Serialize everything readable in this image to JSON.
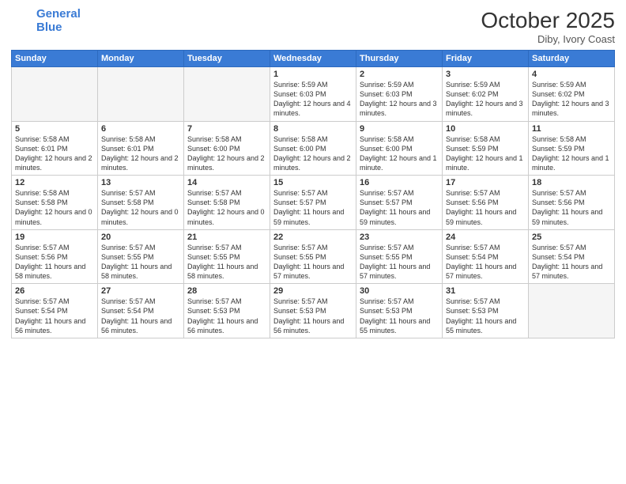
{
  "header": {
    "logo_line1": "General",
    "logo_line2": "Blue",
    "month": "October 2025",
    "location": "Diby, Ivory Coast"
  },
  "days_of_week": [
    "Sunday",
    "Monday",
    "Tuesday",
    "Wednesday",
    "Thursday",
    "Friday",
    "Saturday"
  ],
  "weeks": [
    [
      {
        "day": "",
        "data": ""
      },
      {
        "day": "",
        "data": ""
      },
      {
        "day": "",
        "data": ""
      },
      {
        "day": "1",
        "data": "Sunrise: 5:59 AM\nSunset: 6:03 PM\nDaylight: 12 hours and 4 minutes."
      },
      {
        "day": "2",
        "data": "Sunrise: 5:59 AM\nSunset: 6:03 PM\nDaylight: 12 hours and 3 minutes."
      },
      {
        "day": "3",
        "data": "Sunrise: 5:59 AM\nSunset: 6:02 PM\nDaylight: 12 hours and 3 minutes."
      },
      {
        "day": "4",
        "data": "Sunrise: 5:59 AM\nSunset: 6:02 PM\nDaylight: 12 hours and 3 minutes."
      }
    ],
    [
      {
        "day": "5",
        "data": "Sunrise: 5:58 AM\nSunset: 6:01 PM\nDaylight: 12 hours and 2 minutes."
      },
      {
        "day": "6",
        "data": "Sunrise: 5:58 AM\nSunset: 6:01 PM\nDaylight: 12 hours and 2 minutes."
      },
      {
        "day": "7",
        "data": "Sunrise: 5:58 AM\nSunset: 6:00 PM\nDaylight: 12 hours and 2 minutes."
      },
      {
        "day": "8",
        "data": "Sunrise: 5:58 AM\nSunset: 6:00 PM\nDaylight: 12 hours and 2 minutes."
      },
      {
        "day": "9",
        "data": "Sunrise: 5:58 AM\nSunset: 6:00 PM\nDaylight: 12 hours and 1 minute."
      },
      {
        "day": "10",
        "data": "Sunrise: 5:58 AM\nSunset: 5:59 PM\nDaylight: 12 hours and 1 minute."
      },
      {
        "day": "11",
        "data": "Sunrise: 5:58 AM\nSunset: 5:59 PM\nDaylight: 12 hours and 1 minute."
      }
    ],
    [
      {
        "day": "12",
        "data": "Sunrise: 5:58 AM\nSunset: 5:58 PM\nDaylight: 12 hours and 0 minutes."
      },
      {
        "day": "13",
        "data": "Sunrise: 5:57 AM\nSunset: 5:58 PM\nDaylight: 12 hours and 0 minutes."
      },
      {
        "day": "14",
        "data": "Sunrise: 5:57 AM\nSunset: 5:58 PM\nDaylight: 12 hours and 0 minutes."
      },
      {
        "day": "15",
        "data": "Sunrise: 5:57 AM\nSunset: 5:57 PM\nDaylight: 11 hours and 59 minutes."
      },
      {
        "day": "16",
        "data": "Sunrise: 5:57 AM\nSunset: 5:57 PM\nDaylight: 11 hours and 59 minutes."
      },
      {
        "day": "17",
        "data": "Sunrise: 5:57 AM\nSunset: 5:56 PM\nDaylight: 11 hours and 59 minutes."
      },
      {
        "day": "18",
        "data": "Sunrise: 5:57 AM\nSunset: 5:56 PM\nDaylight: 11 hours and 59 minutes."
      }
    ],
    [
      {
        "day": "19",
        "data": "Sunrise: 5:57 AM\nSunset: 5:56 PM\nDaylight: 11 hours and 58 minutes."
      },
      {
        "day": "20",
        "data": "Sunrise: 5:57 AM\nSunset: 5:55 PM\nDaylight: 11 hours and 58 minutes."
      },
      {
        "day": "21",
        "data": "Sunrise: 5:57 AM\nSunset: 5:55 PM\nDaylight: 11 hours and 58 minutes."
      },
      {
        "day": "22",
        "data": "Sunrise: 5:57 AM\nSunset: 5:55 PM\nDaylight: 11 hours and 57 minutes."
      },
      {
        "day": "23",
        "data": "Sunrise: 5:57 AM\nSunset: 5:55 PM\nDaylight: 11 hours and 57 minutes."
      },
      {
        "day": "24",
        "data": "Sunrise: 5:57 AM\nSunset: 5:54 PM\nDaylight: 11 hours and 57 minutes."
      },
      {
        "day": "25",
        "data": "Sunrise: 5:57 AM\nSunset: 5:54 PM\nDaylight: 11 hours and 57 minutes."
      }
    ],
    [
      {
        "day": "26",
        "data": "Sunrise: 5:57 AM\nSunset: 5:54 PM\nDaylight: 11 hours and 56 minutes."
      },
      {
        "day": "27",
        "data": "Sunrise: 5:57 AM\nSunset: 5:54 PM\nDaylight: 11 hours and 56 minutes."
      },
      {
        "day": "28",
        "data": "Sunrise: 5:57 AM\nSunset: 5:53 PM\nDaylight: 11 hours and 56 minutes."
      },
      {
        "day": "29",
        "data": "Sunrise: 5:57 AM\nSunset: 5:53 PM\nDaylight: 11 hours and 56 minutes."
      },
      {
        "day": "30",
        "data": "Sunrise: 5:57 AM\nSunset: 5:53 PM\nDaylight: 11 hours and 55 minutes."
      },
      {
        "day": "31",
        "data": "Sunrise: 5:57 AM\nSunset: 5:53 PM\nDaylight: 11 hours and 55 minutes."
      },
      {
        "day": "",
        "data": ""
      }
    ]
  ]
}
